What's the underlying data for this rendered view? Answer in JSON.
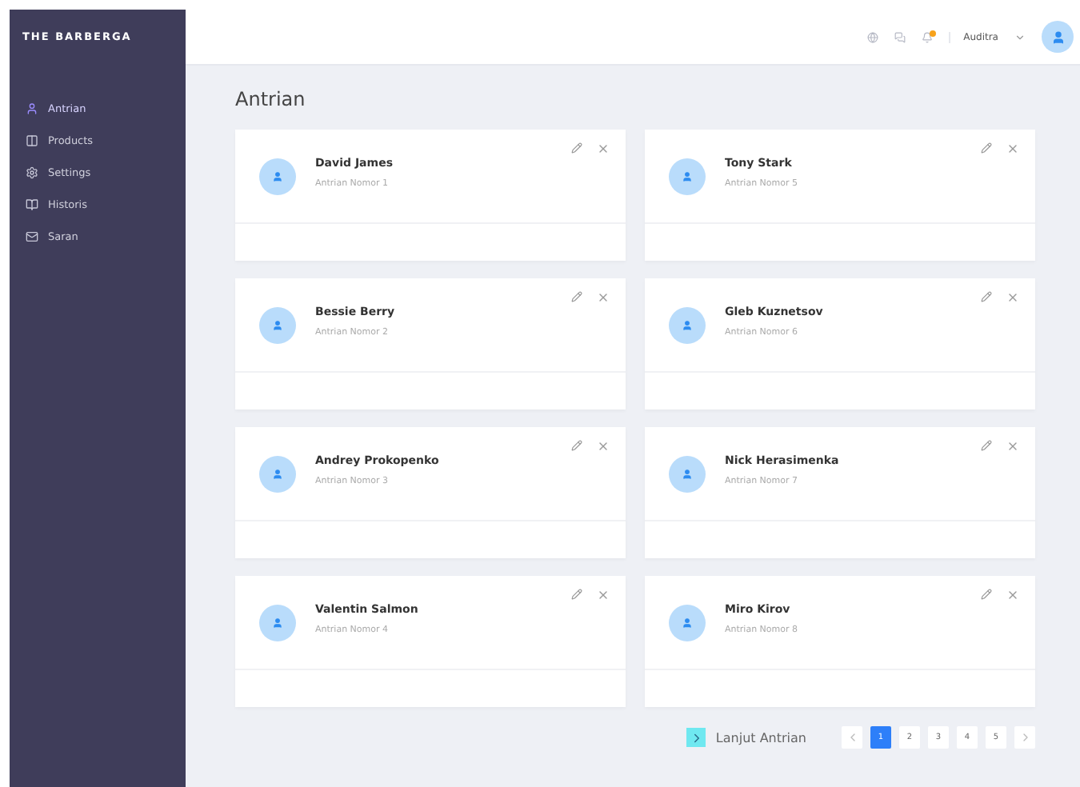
{
  "sidebar": {
    "brand": "THE BARBERGA",
    "items": [
      {
        "label": "Antrian",
        "selected": true
      },
      {
        "label": "Products",
        "selected": false
      },
      {
        "label": "Settings",
        "selected": false
      },
      {
        "label": "Historis",
        "selected": false
      },
      {
        "label": "Saran",
        "selected": false
      }
    ]
  },
  "header": {
    "notification_dot": true,
    "user_name": "Auditra"
  },
  "page_title": "Antrian",
  "queue": [
    {
      "name": "David James",
      "number": "Antrian Nomor 1"
    },
    {
      "name": "Bessie Berry",
      "number": "Antrian Nomor 2"
    },
    {
      "name": "Andrey Prokopenko",
      "number": "Antrian Nomor 3"
    },
    {
      "name": "Valentin Salmon",
      "number": "Antrian Nomor 4"
    },
    {
      "name": "Tony Stark",
      "number": "Antrian Nomor 5"
    },
    {
      "name": "Gleb Kuznetsov",
      "number": "Antrian Nomor 6"
    },
    {
      "name": "Nick Herasimenka",
      "number": "Antrian Nomor 7"
    },
    {
      "name": "Miro Kirov",
      "number": "Antrian Nomor 8"
    }
  ],
  "next_button": {
    "label": "Lanjut Antrian"
  },
  "pagination": [
    {
      "label": "1",
      "selected": true
    },
    {
      "label": "2",
      "selected": false
    },
    {
      "label": "3",
      "selected": false
    },
    {
      "label": "4",
      "selected": false
    },
    {
      "label": "5",
      "selected": false
    }
  ]
}
